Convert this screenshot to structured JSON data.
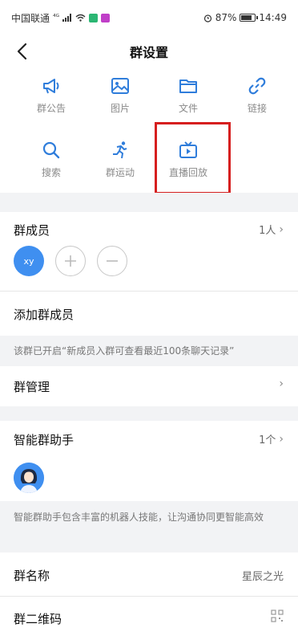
{
  "status_bar": {
    "carrier": "中国联通",
    "network": "⁴ᴳ",
    "battery": "87%",
    "time": "14:49"
  },
  "header": {
    "title": "群设置"
  },
  "tools": [
    {
      "label": "群公告",
      "icon": "megaphone-icon"
    },
    {
      "label": "图片",
      "icon": "image-icon"
    },
    {
      "label": "文件",
      "icon": "folder-icon"
    },
    {
      "label": "链接",
      "icon": "link-icon"
    },
    {
      "label": "搜索",
      "icon": "search-icon"
    },
    {
      "label": "群运动",
      "icon": "running-icon"
    },
    {
      "label": "直播回放",
      "icon": "tv-playback-icon"
    }
  ],
  "members": {
    "label": "群成员",
    "count": "1人",
    "self_initials": "xy"
  },
  "add_member": {
    "label": "添加群成员",
    "notice": "该群已开启“新成员入群可查看最近100条聊天记录”"
  },
  "manage": {
    "label": "群管理"
  },
  "assistant": {
    "label": "智能群助手",
    "count": "1个",
    "description": "智能群助手包含丰富的机器人技能，让沟通协同更智能高效"
  },
  "group_name": {
    "label": "群名称",
    "value": "星辰之光"
  },
  "group_qr": {
    "label": "群二维码"
  },
  "colors": {
    "accent": "#3f8ff0",
    "highlight": "#d61f1f",
    "background": "#f2f3f5"
  }
}
